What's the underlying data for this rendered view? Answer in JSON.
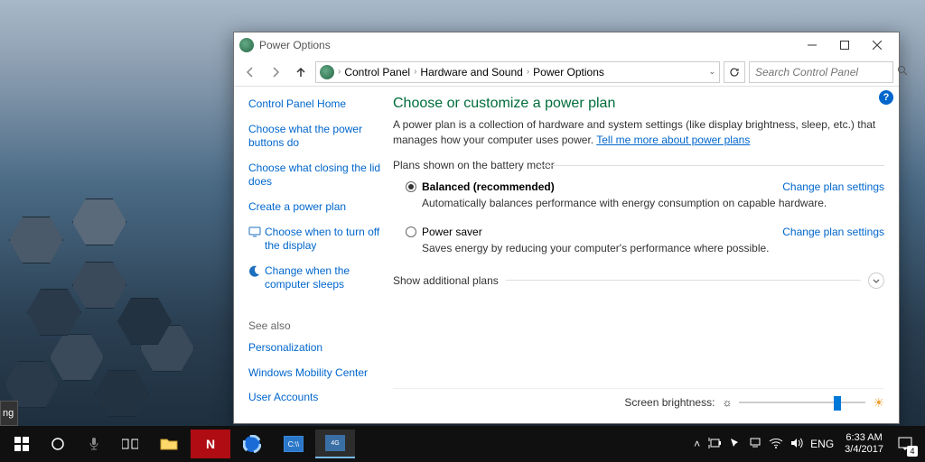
{
  "window": {
    "title": "Power Options",
    "breadcrumb": {
      "root": "Control Panel",
      "mid": "Hardware and Sound",
      "leaf": "Power Options"
    },
    "search_placeholder": "Search Control Panel"
  },
  "sidebar": {
    "home": "Control Panel Home",
    "links": {
      "l1": "Choose what the power buttons do",
      "l2": "Choose what closing the lid does",
      "l3": "Create a power plan",
      "l4": "Choose when to turn off the display",
      "l5": "Change when the computer sleeps"
    },
    "seealso_label": "See also",
    "seealso": {
      "s1": "Personalization",
      "s2": "Windows Mobility Center",
      "s3": "User Accounts"
    }
  },
  "main": {
    "heading": "Choose or customize a power plan",
    "desc_pre": "A power plan is a collection of hardware and system settings (like display brightness, sleep, etc.) that manages how your computer uses power. ",
    "desc_link": "Tell me more about power plans",
    "plans_label": "Plans shown on the battery meter",
    "plan1": {
      "name": "Balanced (recommended)",
      "desc": "Automatically balances performance with energy consumption on capable hardware.",
      "change": "Change plan settings"
    },
    "plan2": {
      "name": "Power saver",
      "desc": "Saves energy by reducing your computer's performance where possible.",
      "change": "Change plan settings"
    },
    "expand_label": "Show additional plans",
    "brightness_label": "Screen brightness:"
  },
  "taskbar": {
    "lang": "ENG",
    "time": "6:33 AM",
    "date": "3/4/2017",
    "notif_count": "4",
    "partial": "ng"
  }
}
